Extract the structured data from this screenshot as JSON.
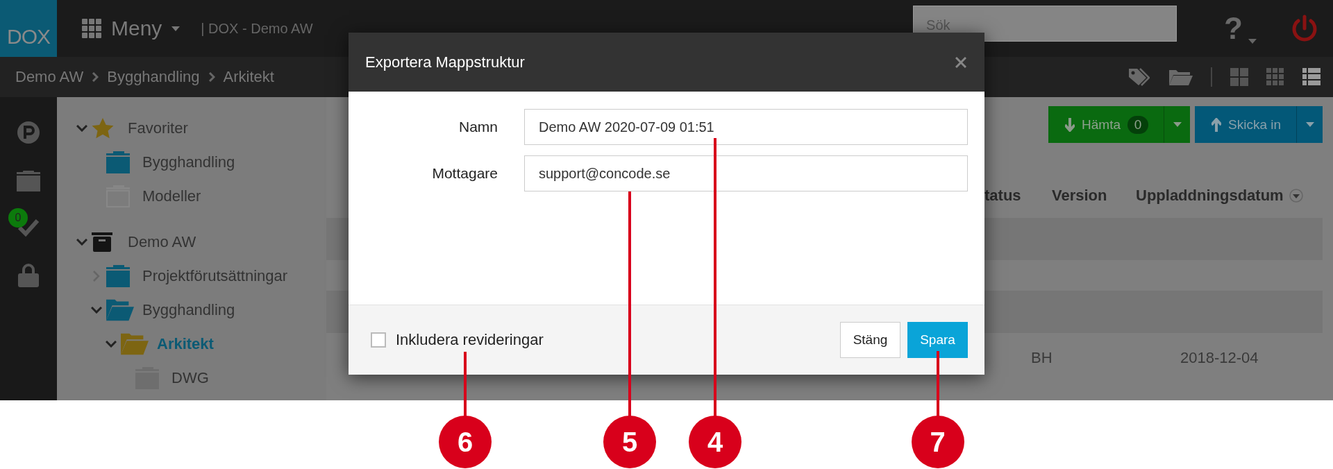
{
  "header": {
    "logo": "DOX",
    "menu_label": "Meny",
    "title": "| DOX - Demo AW",
    "search": {
      "placeholder": "Sök"
    },
    "help": "?"
  },
  "breadcrumb": [
    "Demo AW",
    "Bygghandling",
    "Arkitekt"
  ],
  "view_buttons": [
    {
      "kind": "large-grid",
      "selected": false
    },
    {
      "kind": "small-grid",
      "selected": false
    },
    {
      "kind": "list",
      "selected": true
    }
  ],
  "rail": [
    {
      "kind": "parking"
    },
    {
      "kind": "folder"
    },
    {
      "kind": "tasks",
      "badge": "0"
    },
    {
      "kind": "lock"
    }
  ],
  "tree": [
    {
      "label": "Favoriter",
      "kind": "star",
      "expanded": true,
      "selected": false,
      "children": [
        {
          "label": "Bygghandling",
          "kind": "folder-blue",
          "selected": false
        },
        {
          "label": "Modeller",
          "kind": "folder-empty",
          "selected": false
        }
      ]
    },
    {
      "label": "Demo AW",
      "kind": "archive",
      "expanded": true,
      "selected": false,
      "children": [
        {
          "label": "Projektförutsättningar",
          "kind": "folder-blue",
          "expanded": false,
          "selected": false
        },
        {
          "label": "Bygghandling",
          "kind": "folder-blue-open",
          "expanded": true,
          "selected": false,
          "children": [
            {
              "label": "Arkitekt",
              "kind": "folder-yellow-open",
              "expanded": true,
              "selected": true,
              "children": [
                {
                  "label": "DWG",
                  "kind": "folder-grey",
                  "selected": false
                }
              ]
            }
          ]
        }
      ]
    }
  ],
  "actions": [
    {
      "kind": "download",
      "label": "Hämta",
      "count": "0"
    },
    {
      "kind": "upload",
      "label": "Skicka in"
    }
  ],
  "table": {
    "columns": [
      "tatus",
      "Version",
      "Uppladdningsdatum"
    ],
    "rows": [
      {
        "cells": [
          "BH",
          "",
          "2018-12-04"
        ]
      }
    ]
  },
  "dialog": {
    "title": "Exportera Mappstruktur",
    "fields": [
      {
        "label": "Namn",
        "value": "Demo AW 2020-07-09 01:51"
      },
      {
        "label": "Mottagare",
        "value": "support@concode.se"
      }
    ],
    "checkbox": {
      "label": "Inkludera revideringar",
      "checked": false
    },
    "buttons": [
      {
        "kind": "secondary",
        "label": "Stäng"
      },
      {
        "kind": "primary",
        "label": "Spara"
      }
    ]
  },
  "callouts": [
    {
      "number": "6"
    },
    {
      "number": "5"
    },
    {
      "number": "4"
    },
    {
      "number": "7"
    }
  ]
}
